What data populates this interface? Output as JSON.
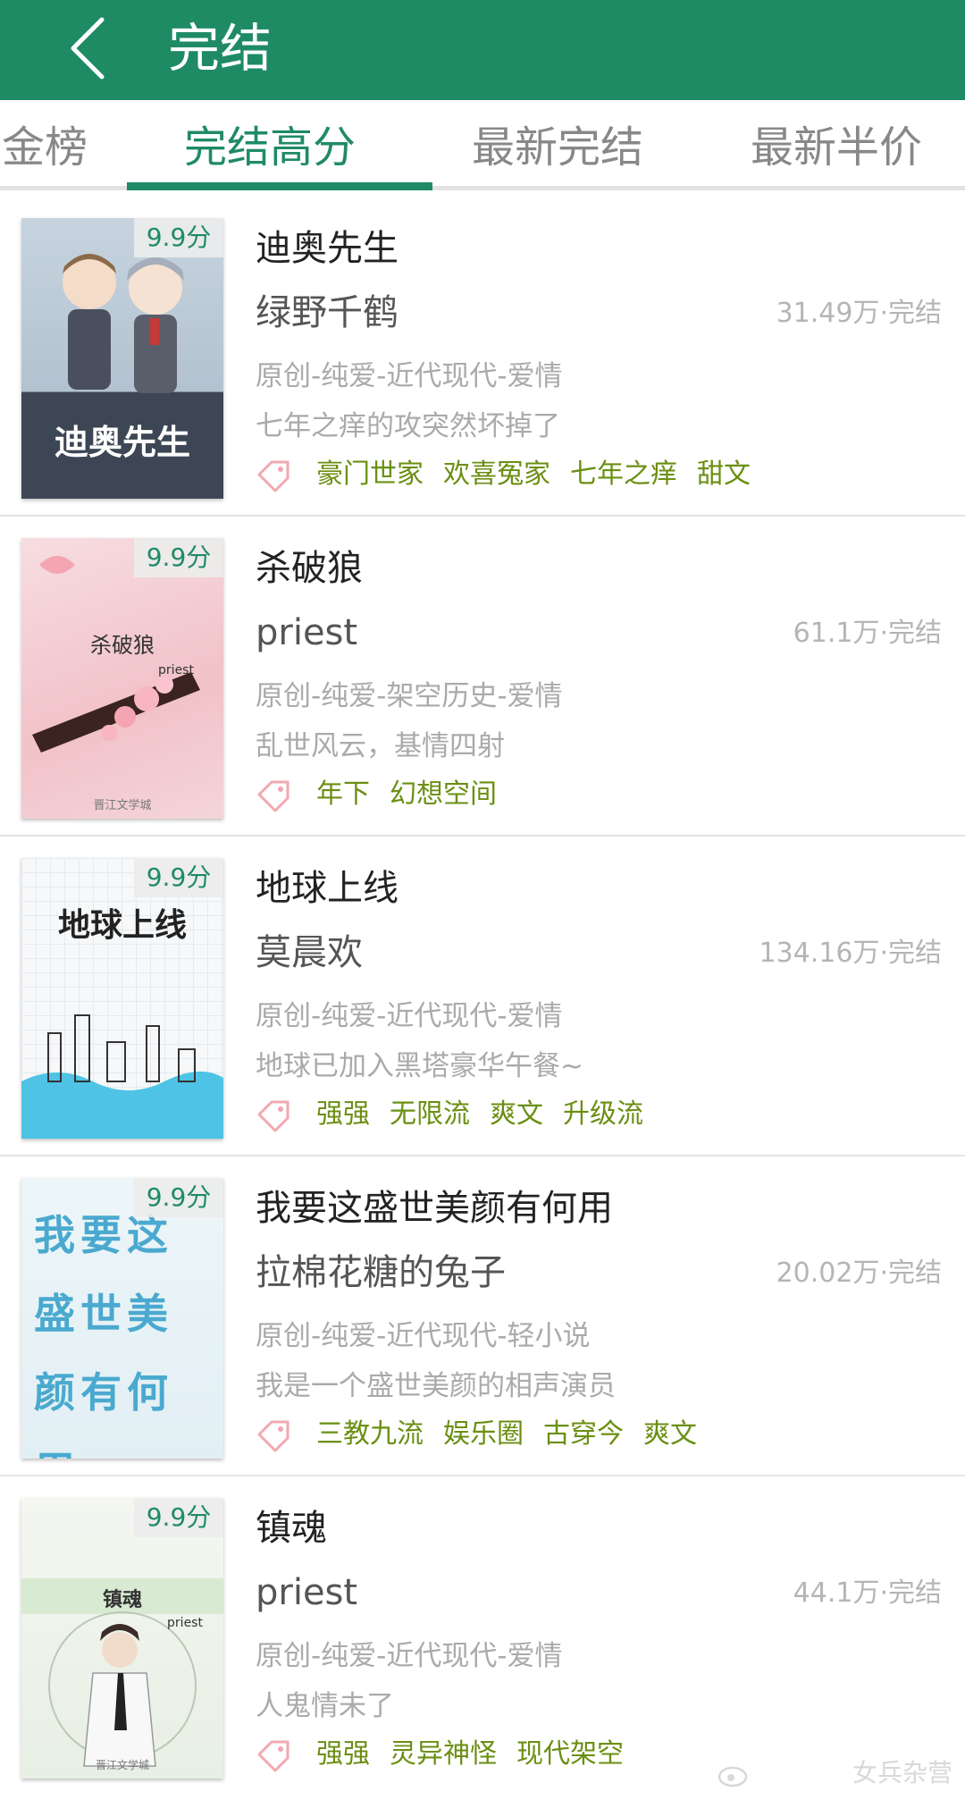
{
  "header": {
    "title": "完结",
    "back_icon": "chevron-left-icon",
    "background": "#1f8b65"
  },
  "tabs": [
    {
      "label": "金榜",
      "active": false
    },
    {
      "label": "完结高分",
      "active": true
    },
    {
      "label": "最新完结",
      "active": false
    },
    {
      "label": "最新半价",
      "active": false
    }
  ],
  "books": [
    {
      "score": "9.9分",
      "title": "迪奥先生",
      "author": "绿野千鹤",
      "stats": "31.49万·完结",
      "genre": "原创-纯爱-近代现代-爱情",
      "desc": "七年之痒的攻突然坏掉了",
      "tags": [
        "豪门世家",
        "欢喜冤家",
        "七年之痒",
        "甜文"
      ],
      "cover_text": "迪奥先生",
      "cover_color": "#b9c8d6"
    },
    {
      "score": "9.9分",
      "title": "杀破狼",
      "author": "priest",
      "stats": "61.1万·完结",
      "genre": "原创-纯爱-架空历史-爱情",
      "desc": "乱世风云，基情四射",
      "tags": [
        "年下",
        "幻想空间"
      ],
      "cover_text": "杀破狼",
      "cover_sub": "priest",
      "cover_footer": "晋江文学城",
      "cover_color": "#f3c9cf"
    },
    {
      "score": "9.9分",
      "title": "地球上线",
      "author": "莫晨欢",
      "stats": "134.16万·完结",
      "genre": "原创-纯爱-近代现代-爱情",
      "desc": "地球已加入黑塔豪华午餐~",
      "tags": [
        "强强",
        "无限流",
        "爽文",
        "升级流"
      ],
      "cover_text": "地球上线",
      "cover_color": "#f5f7f9"
    },
    {
      "score": "9.9分",
      "title": "我要这盛世美颜有何用",
      "author": "拉棉花糖的兔子",
      "stats": "20.02万·完结",
      "genre": "原创-纯爱-近代现代-轻小说",
      "desc": "我是一个盛世美颜的相声演员",
      "tags": [
        "三教九流",
        "娱乐圈",
        "古穿今",
        "爽文"
      ],
      "cover_text": "我要这盛世美颜有何用",
      "cover_color": "#e9f3f7"
    },
    {
      "score": "9.9分",
      "title": "镇魂",
      "author": "priest",
      "stats": "44.1万·完结",
      "genre": "原创-纯爱-近代现代-爱情",
      "desc": "人鬼情未了",
      "tags": [
        "强强",
        "灵异神怪",
        "现代架空"
      ],
      "cover_text": "镇魂",
      "cover_sub": "priest",
      "cover_footer": "晋江文学城",
      "cover_color": "#eef2ea"
    }
  ],
  "watermark": "女兵杂营",
  "colors": {
    "accent": "#1f8b65",
    "tag": "#6a8f12",
    "tag_icon": "#f2a8b0"
  }
}
